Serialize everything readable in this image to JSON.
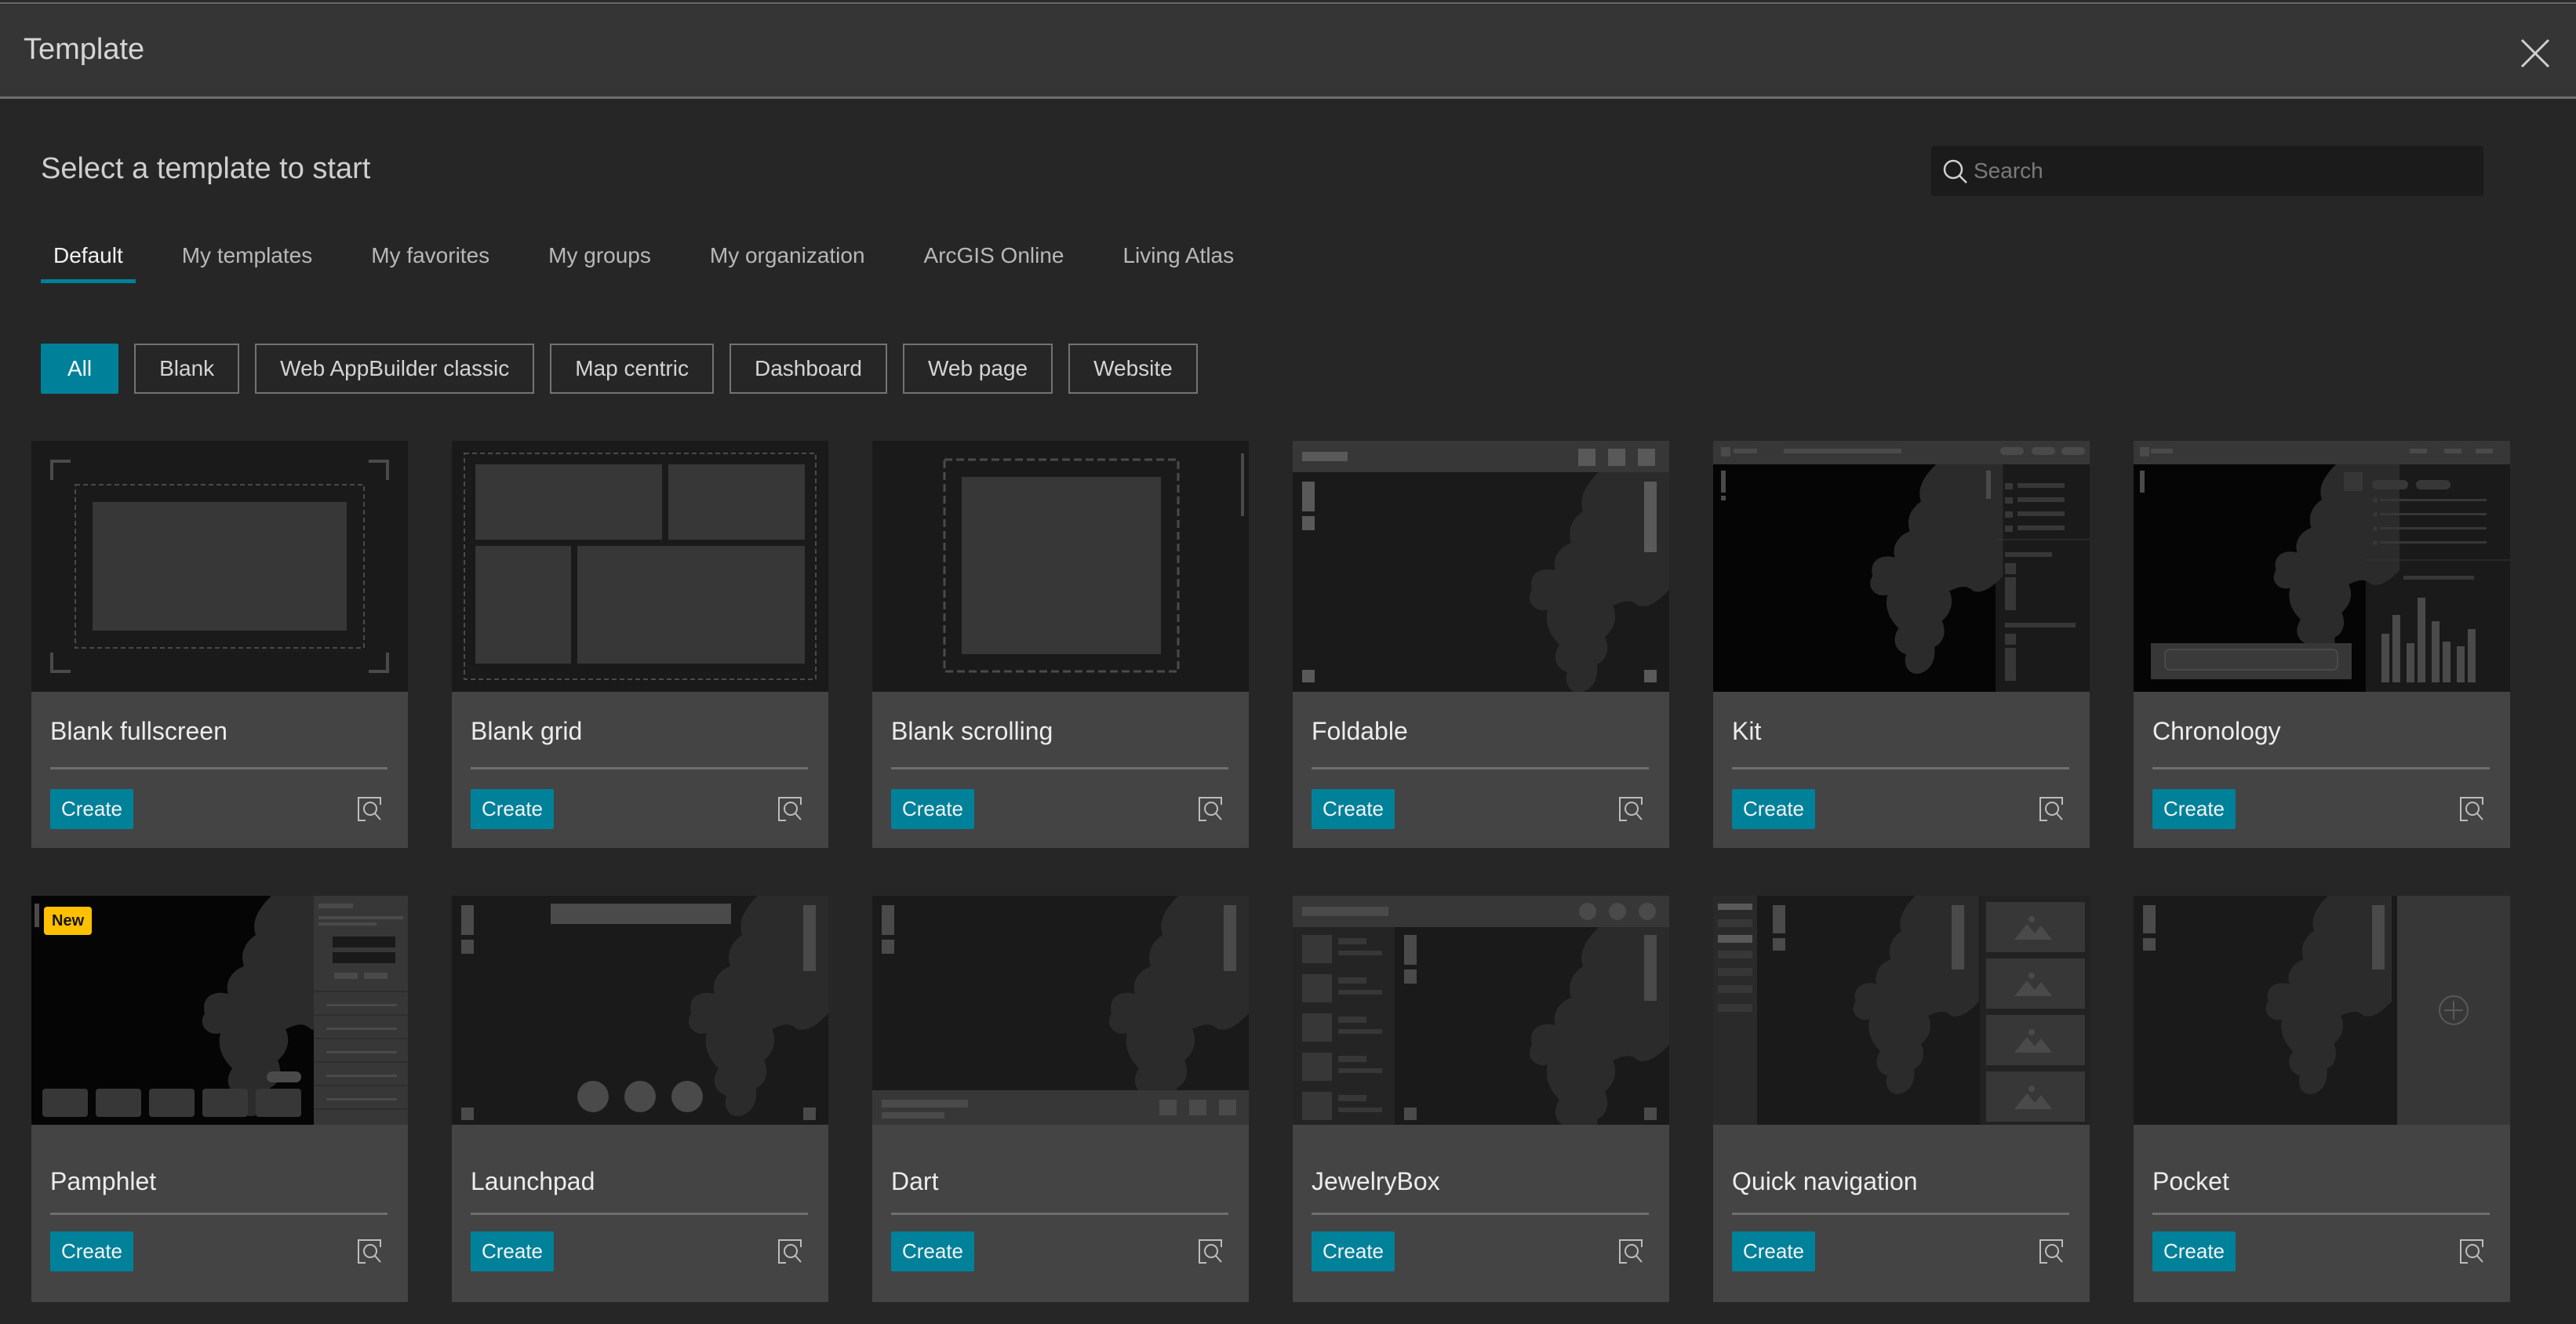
{
  "dialog": {
    "title": "Template",
    "close_icon": "close-icon"
  },
  "subtitle": "Select a template to start",
  "search": {
    "placeholder": "Search",
    "value": "",
    "icon": "search-icon"
  },
  "tabs": [
    {
      "label": "Default",
      "active": true
    },
    {
      "label": "My templates",
      "active": false
    },
    {
      "label": "My favorites",
      "active": false
    },
    {
      "label": "My groups",
      "active": false
    },
    {
      "label": "My organization",
      "active": false
    },
    {
      "label": "ArcGIS Online",
      "active": false
    },
    {
      "label": "Living Atlas",
      "active": false
    }
  ],
  "filters": [
    {
      "label": "All",
      "active": true
    },
    {
      "label": "Blank",
      "active": false
    },
    {
      "label": "Web AppBuilder classic",
      "active": false
    },
    {
      "label": "Map centric",
      "active": false
    },
    {
      "label": "Dashboard",
      "active": false
    },
    {
      "label": "Web page",
      "active": false
    },
    {
      "label": "Website",
      "active": false
    }
  ],
  "card_actions": {
    "create_label": "Create",
    "preview_icon": "preview-icon"
  },
  "templates": [
    {
      "name": "Blank fullscreen",
      "thumb": "blank-fullscreen"
    },
    {
      "name": "Blank grid",
      "thumb": "blank-grid"
    },
    {
      "name": "Blank scrolling",
      "thumb": "blank-scrolling"
    },
    {
      "name": "Foldable",
      "thumb": "foldable"
    },
    {
      "name": "Kit",
      "thumb": "kit"
    },
    {
      "name": "Chronology",
      "thumb": "chronology"
    },
    {
      "name": "Pamphlet",
      "thumb": "pamphlet",
      "badge": "New"
    },
    {
      "name": "Launchpad",
      "thumb": "launchpad"
    },
    {
      "name": "Dart",
      "thumb": "dart"
    },
    {
      "name": "JewelryBox",
      "thumb": "jewelrybox"
    },
    {
      "name": "Quick navigation",
      "thumb": "quick-navigation"
    },
    {
      "name": "Pocket",
      "thumb": "pocket"
    }
  ],
  "colors": {
    "accent": "#00819a",
    "badge": "#ffc000",
    "header_bg": "#353535",
    "page_bg": "#262626",
    "card_bg": "#444444"
  }
}
